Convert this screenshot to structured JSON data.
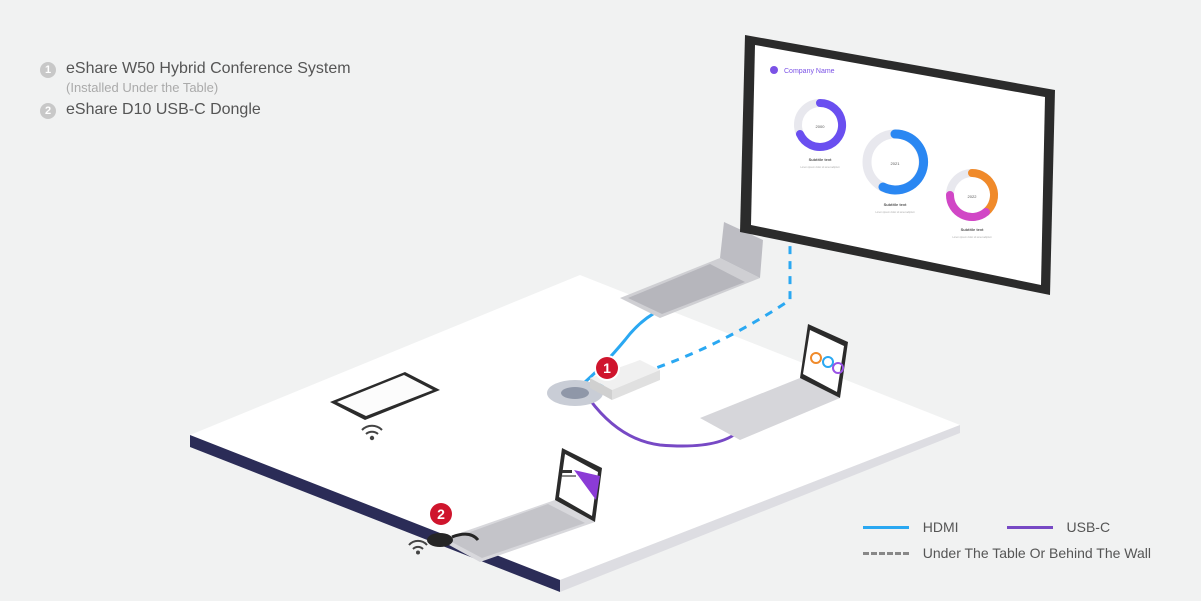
{
  "labels": {
    "item1": {
      "num": "1",
      "title": "eShare W50 Hybrid Conference System",
      "note": "(Installed Under the Table)"
    },
    "item2": {
      "num": "2",
      "title": "eShare D10 USB-C Dongle"
    }
  },
  "legend": {
    "hdmi": {
      "label": "HDMI",
      "color": "#2aa8f2"
    },
    "usbc": {
      "label": "USB-C",
      "color": "#7749c5"
    },
    "hidden": {
      "label": "Under The Table Or Behind The Wall"
    }
  },
  "badges": {
    "b1": "1",
    "b2": "2"
  },
  "display_chart": {
    "heading": "Company Name",
    "rings": [
      {
        "value": "2000",
        "sub": "Subtitle text"
      },
      {
        "value": "2021",
        "sub": "Subtitle text"
      },
      {
        "value": "2022",
        "sub": "Subtitle text"
      }
    ]
  }
}
